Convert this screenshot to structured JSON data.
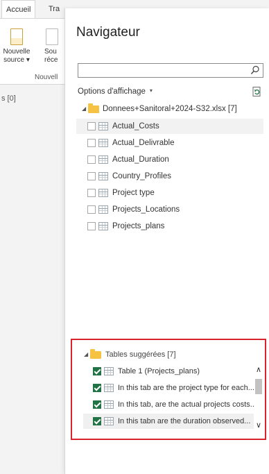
{
  "background_app": {
    "tabs": [
      "Accueil",
      "Tra"
    ],
    "buttons": [
      {
        "label_line1": "Nouvelle",
        "label_line2": "source ▾"
      },
      {
        "label_line1": "Sou",
        "label_line2": "réce"
      }
    ],
    "group_label": "Nouvell",
    "left_label": "s [0]"
  },
  "navigator": {
    "title": "Navigateur",
    "search": {
      "value": "",
      "placeholder": ""
    },
    "options_label": "Options d'affichage",
    "options_caret": "▾",
    "tree": {
      "root_expander": "◢",
      "root_label": "Donnees+Sanitoral+2024-S32.xlsx [7]",
      "items": [
        {
          "label": "Actual_Costs",
          "checked": false,
          "highlighted": true
        },
        {
          "label": "Actual_Delivrable",
          "checked": false,
          "highlighted": false
        },
        {
          "label": "Actual_Duration",
          "checked": false,
          "highlighted": false
        },
        {
          "label": "Country_Profiles",
          "checked": false,
          "highlighted": false
        },
        {
          "label": "Project type",
          "checked": false,
          "highlighted": false
        },
        {
          "label": "Projects_Locations",
          "checked": false,
          "highlighted": false
        },
        {
          "label": "Projects_plans",
          "checked": false,
          "highlighted": false
        }
      ]
    },
    "suggested": {
      "root_expander": "◢",
      "root_label": "Tables suggérées [7]",
      "items": [
        {
          "label": "Table 1 (Projects_plans)",
          "checked": true,
          "highlighted": false
        },
        {
          "label": "In this tab are the project type for each...",
          "checked": true,
          "highlighted": false
        },
        {
          "label": "In this tab, are the actual projects costs...",
          "checked": true,
          "highlighted": false
        },
        {
          "label": "In this tabn are the duration observed...",
          "checked": true,
          "highlighted": true
        }
      ],
      "scroll_up": "∧",
      "scroll_down": "∨"
    }
  },
  "colors": {
    "highlight_border": "#d9232a",
    "checkbox_checked": "#217346",
    "folder": "#f5c242"
  }
}
